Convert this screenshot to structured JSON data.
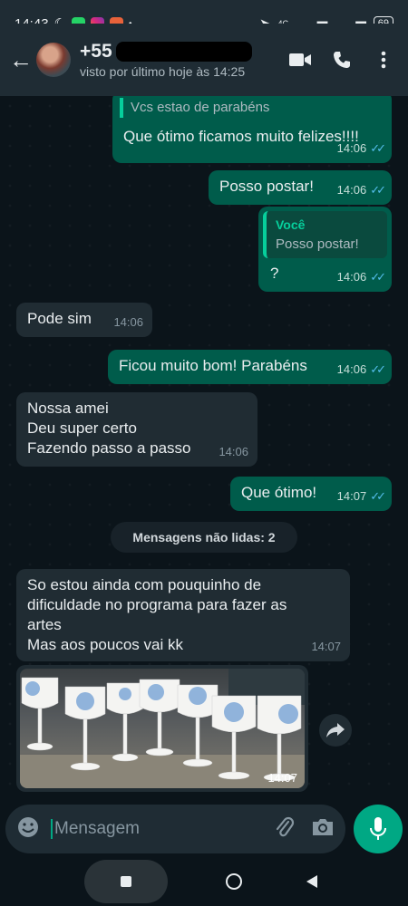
{
  "status_bar": {
    "time": "14:43",
    "network": "4G",
    "battery": "69"
  },
  "header": {
    "contact_name": "+55",
    "last_seen": "visto por último hoje às 14:25"
  },
  "messages": [
    {
      "dir": "out",
      "quote_text": "Vcs estao de parabéns",
      "text": "Que ótimo ficamos muito felizes!!!!",
      "time": "14:06"
    },
    {
      "dir": "out",
      "text": "Posso postar!",
      "time": "14:06"
    },
    {
      "dir": "out",
      "quote_name": "Você",
      "quote_text": "Posso postar!",
      "text": "?",
      "time": "14:06"
    },
    {
      "dir": "in",
      "text": "Pode sim",
      "time": "14:06"
    },
    {
      "dir": "out",
      "text": "Ficou muito bom! Parabéns",
      "time": "14:06"
    },
    {
      "dir": "in",
      "lines": [
        "Nossa amei",
        "Deu super certo",
        "Fazendo passo a passo"
      ],
      "time": "14:06"
    },
    {
      "dir": "out",
      "text": "Que ótimo!",
      "time": "14:07"
    },
    {
      "dir": "in",
      "lines": [
        "So estou ainda com pouquinho de",
        "dificuldade no programa para fazer as",
        "artes",
        "Mas aos poucos vai kk"
      ],
      "time": "14:07"
    },
    {
      "dir": "in",
      "type": "image",
      "time": "14:07"
    }
  ],
  "unread_divider": "Mensagens não lidas: 2",
  "input": {
    "placeholder": "Mensagem"
  },
  "colors": {
    "outgoing_bubble": "#005c4b",
    "incoming_bubble": "#202c33",
    "accent": "#00a884",
    "read_ticks": "#53bdeb"
  }
}
